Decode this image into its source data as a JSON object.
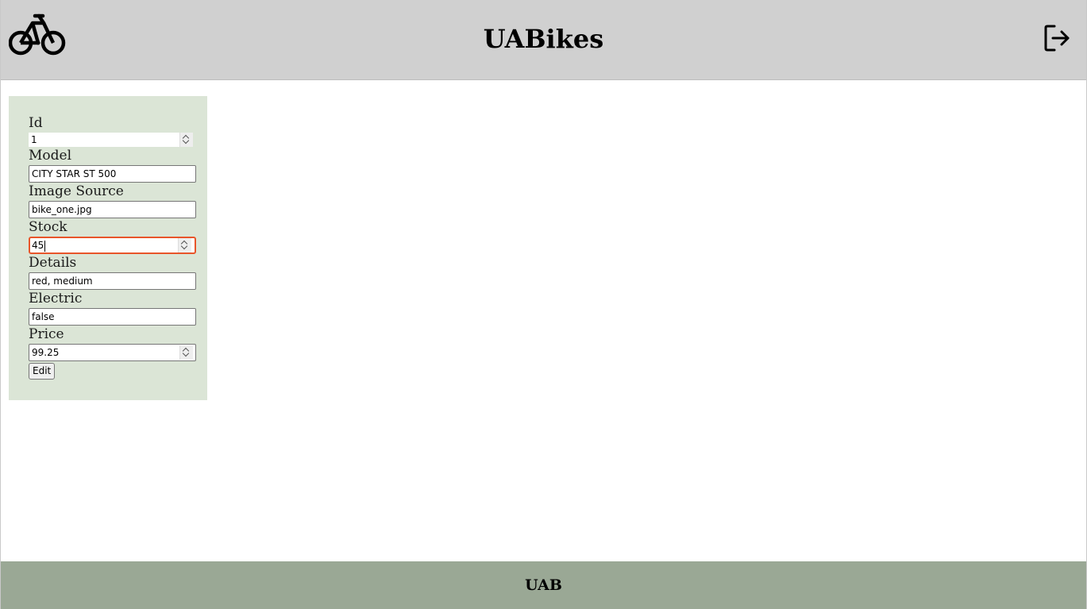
{
  "header": {
    "title": "UABikes",
    "logo_icon": "bicycle-icon",
    "logout_icon": "logout-icon"
  },
  "form": {
    "fields": [
      {
        "label": "Id",
        "value": "1",
        "type": "number"
      },
      {
        "label": "Model",
        "value": "CITY STAR ST 500",
        "type": "text"
      },
      {
        "label": "Image Source",
        "value": "bike_one.jpg",
        "type": "text"
      },
      {
        "label": "Stock",
        "value": "45",
        "type": "number",
        "focused": true
      },
      {
        "label": "Details",
        "value": "red, medium",
        "type": "text"
      },
      {
        "label": "Electric",
        "value": "false",
        "type": "text"
      },
      {
        "label": "Price",
        "value": "99.25",
        "type": "number"
      }
    ],
    "submit_label": "Edit"
  },
  "footer": {
    "text": "UAB"
  },
  "colors": {
    "header_bg": "#d0d0d0",
    "panel_bg": "#dbe5d6",
    "footer_bg": "#9aa895",
    "focus_border": "#e8552a"
  }
}
